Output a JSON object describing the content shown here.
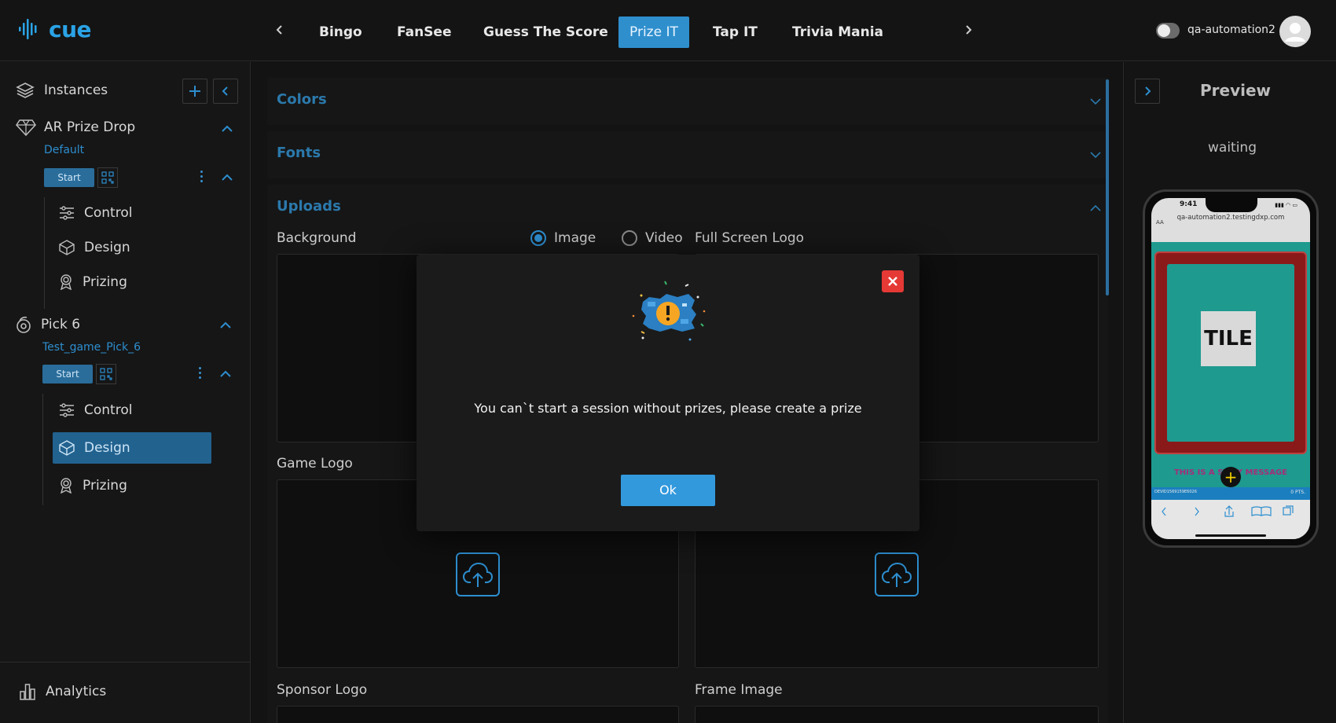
{
  "header": {
    "logo_text": "cue",
    "tabs": [
      {
        "label": "Bingo"
      },
      {
        "label": "FanSee"
      },
      {
        "label": "Guess The Score"
      },
      {
        "label": "Prize IT"
      },
      {
        "label": "Tap IT"
      },
      {
        "label": "Trivia Mania"
      }
    ],
    "active_tab": "Prize IT",
    "username": "qa-automation2"
  },
  "sidebar": {
    "title": "Instances",
    "games": [
      {
        "title": "AR Prize Drop",
        "instance": "Default",
        "start_label": "Start",
        "items": [
          {
            "label": "Control"
          },
          {
            "label": "Design"
          },
          {
            "label": "Prizing"
          }
        ]
      },
      {
        "title": "Pick 6",
        "instance": "Test_game_Pick_6",
        "start_label": "Start",
        "items": [
          {
            "label": "Control"
          },
          {
            "label": "Design"
          },
          {
            "label": "Prizing"
          }
        ]
      }
    ],
    "active_item": "Pick 6 / Design",
    "footer": "Analytics"
  },
  "main": {
    "sections": {
      "colors": "Colors",
      "fonts": "Fonts",
      "uploads": "Uploads"
    },
    "uploads": {
      "background": "Background",
      "media_options": [
        "Image",
        "Video"
      ],
      "selected_media": "Image",
      "full_screen_logo": "Full Screen Logo",
      "game_logo": "Game Logo",
      "sponsor_logo": "Sponsor Logo",
      "frame_image": "Frame Image"
    }
  },
  "preview": {
    "title": "Preview",
    "status": "waiting",
    "phone": {
      "time": "9:41",
      "aa": "AA",
      "url": "qa-automation2.testingdxp.com",
      "tile": "TILE",
      "message": "THIS IS A ST  BY MESSAGE",
      "plus": "+",
      "footer_left": "DEVID1569159E6026",
      "footer_right": "0 PTS."
    }
  },
  "modal": {
    "message": "You can`t start a session without prizes, please create a prize",
    "ok_label": "Ok"
  },
  "colors": {
    "accent": "#2f8fcd",
    "section_title": "#2b79ac",
    "close_red": "#e53935",
    "ok_button": "#3399dd"
  }
}
